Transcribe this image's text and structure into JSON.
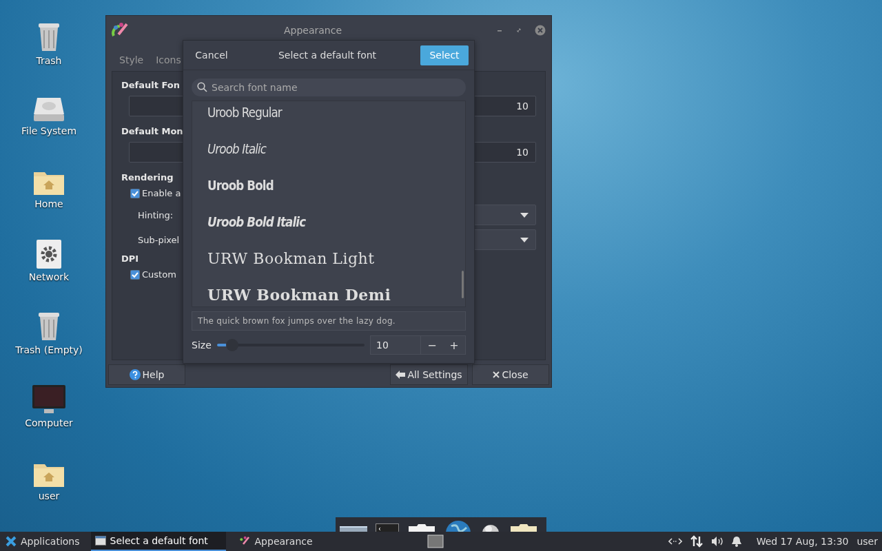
{
  "desktop_icons": [
    {
      "label": "Trash",
      "kind": "trash"
    },
    {
      "label": "File System",
      "kind": "drive"
    },
    {
      "label": "Home",
      "kind": "home"
    },
    {
      "label": "Network",
      "kind": "network"
    },
    {
      "label": "Trash (Empty)",
      "kind": "trash"
    },
    {
      "label": "Computer",
      "kind": "monitor"
    },
    {
      "label": "user",
      "kind": "home"
    }
  ],
  "window": {
    "title": "Appearance",
    "tabs": [
      {
        "label": "Style",
        "selected": false
      },
      {
        "label": "Icons",
        "selected": false
      }
    ],
    "sections": [
      {
        "kind": "field",
        "title": "Default Fon",
        "value": "10"
      },
      {
        "kind": "field",
        "title": "Default Mon",
        "value": "10"
      },
      {
        "kind": "rendering",
        "title": "Rendering",
        "check": {
          "label": "Enable a",
          "checked": true
        },
        "dropdowns": [
          "Hinting:",
          "Sub-pixel"
        ]
      },
      {
        "kind": "dpi",
        "title": "DPI",
        "check": {
          "label": "Custom",
          "checked": true
        }
      }
    ],
    "buttons": [
      {
        "label": "Help",
        "kind": "help"
      },
      {
        "label": "All Settings",
        "kind": "back"
      },
      {
        "label": "Close",
        "kind": "close"
      }
    ]
  },
  "dialog": {
    "cancel": "Cancel",
    "title": "Select a default font",
    "select": "Select",
    "search_placeholder": "Search font name",
    "fonts": [
      {
        "name": "Uroob Regular",
        "kind": "sans"
      },
      {
        "name": "Uroob Italic",
        "kind": "sans-italic"
      },
      {
        "name": "Uroob Bold",
        "kind": "sans-bold"
      },
      {
        "name": "Uroob Bold Italic",
        "kind": "sans-bold-italic"
      },
      {
        "name": "URW Bookman Light",
        "kind": "serif"
      },
      {
        "name": "URW Bookman Demi",
        "kind": "serif-bold"
      }
    ],
    "preview": "The quick brown fox jumps over the lazy dog.",
    "size_label": "Size",
    "size": {
      "level": 0.07
    },
    "size_value": "10",
    "minus": "−",
    "plus": "+"
  },
  "taskbar": {
    "applications": "Applications",
    "tasks": [
      {
        "label": "Select a default font",
        "selected": true,
        "kind": "dialog"
      },
      {
        "label": "Appearance",
        "selected": false,
        "kind": "appearance"
      }
    ],
    "clock": "Wed 17 Aug, 13:30",
    "user": "user"
  }
}
